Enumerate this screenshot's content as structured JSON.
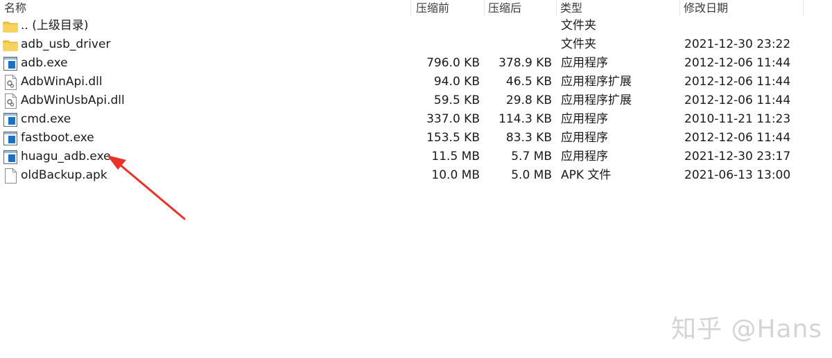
{
  "header": {
    "name": "名称",
    "size": "压缩前",
    "compressed": "压缩后",
    "type": "类型",
    "modified": "修改日期"
  },
  "files": [
    {
      "name": ".. (上级目录)",
      "size": "",
      "compressed": "",
      "type": "文件夹",
      "modified": "",
      "icon": "folder-icon"
    },
    {
      "name": "adb_usb_driver",
      "size": "",
      "compressed": "",
      "type": "文件夹",
      "modified": "2021-12-30 23:22",
      "icon": "folder-icon"
    },
    {
      "name": "adb.exe",
      "size": "796.0 KB",
      "compressed": "378.9 KB",
      "type": "应用程序",
      "modified": "2012-12-06 11:44",
      "icon": "exe-icon"
    },
    {
      "name": "AdbWinApi.dll",
      "size": "94.0 KB",
      "compressed": "46.5 KB",
      "type": "应用程序扩展",
      "modified": "2012-12-06 11:44",
      "icon": "dll-icon"
    },
    {
      "name": "AdbWinUsbApi.dll",
      "size": "59.5 KB",
      "compressed": "29.8 KB",
      "type": "应用程序扩展",
      "modified": "2012-12-06 11:44",
      "icon": "dll-icon"
    },
    {
      "name": "cmd.exe",
      "size": "337.0 KB",
      "compressed": "114.3 KB",
      "type": "应用程序",
      "modified": "2010-11-21 11:23",
      "icon": "exe-icon"
    },
    {
      "name": "fastboot.exe",
      "size": "153.5 KB",
      "compressed": "83.3 KB",
      "type": "应用程序",
      "modified": "2012-12-06 11:44",
      "icon": "exe-icon"
    },
    {
      "name": "huagu_adb.exe",
      "size": "11.5 MB",
      "compressed": "5.7 MB",
      "type": "应用程序",
      "modified": "2021-12-30 23:17",
      "icon": "exe-icon"
    },
    {
      "name": "oldBackup.apk",
      "size": "10.0 MB",
      "compressed": "5.0 MB",
      "type": "APK 文件",
      "modified": "2021-06-13 13:00",
      "icon": "file-icon"
    }
  ],
  "watermark": "知乎 @Hans",
  "colors": {
    "arrow": "#e8322a",
    "folder": "#f5c542",
    "exe_accent": "#1e6fc8",
    "watermark": "#d4d4d4"
  }
}
